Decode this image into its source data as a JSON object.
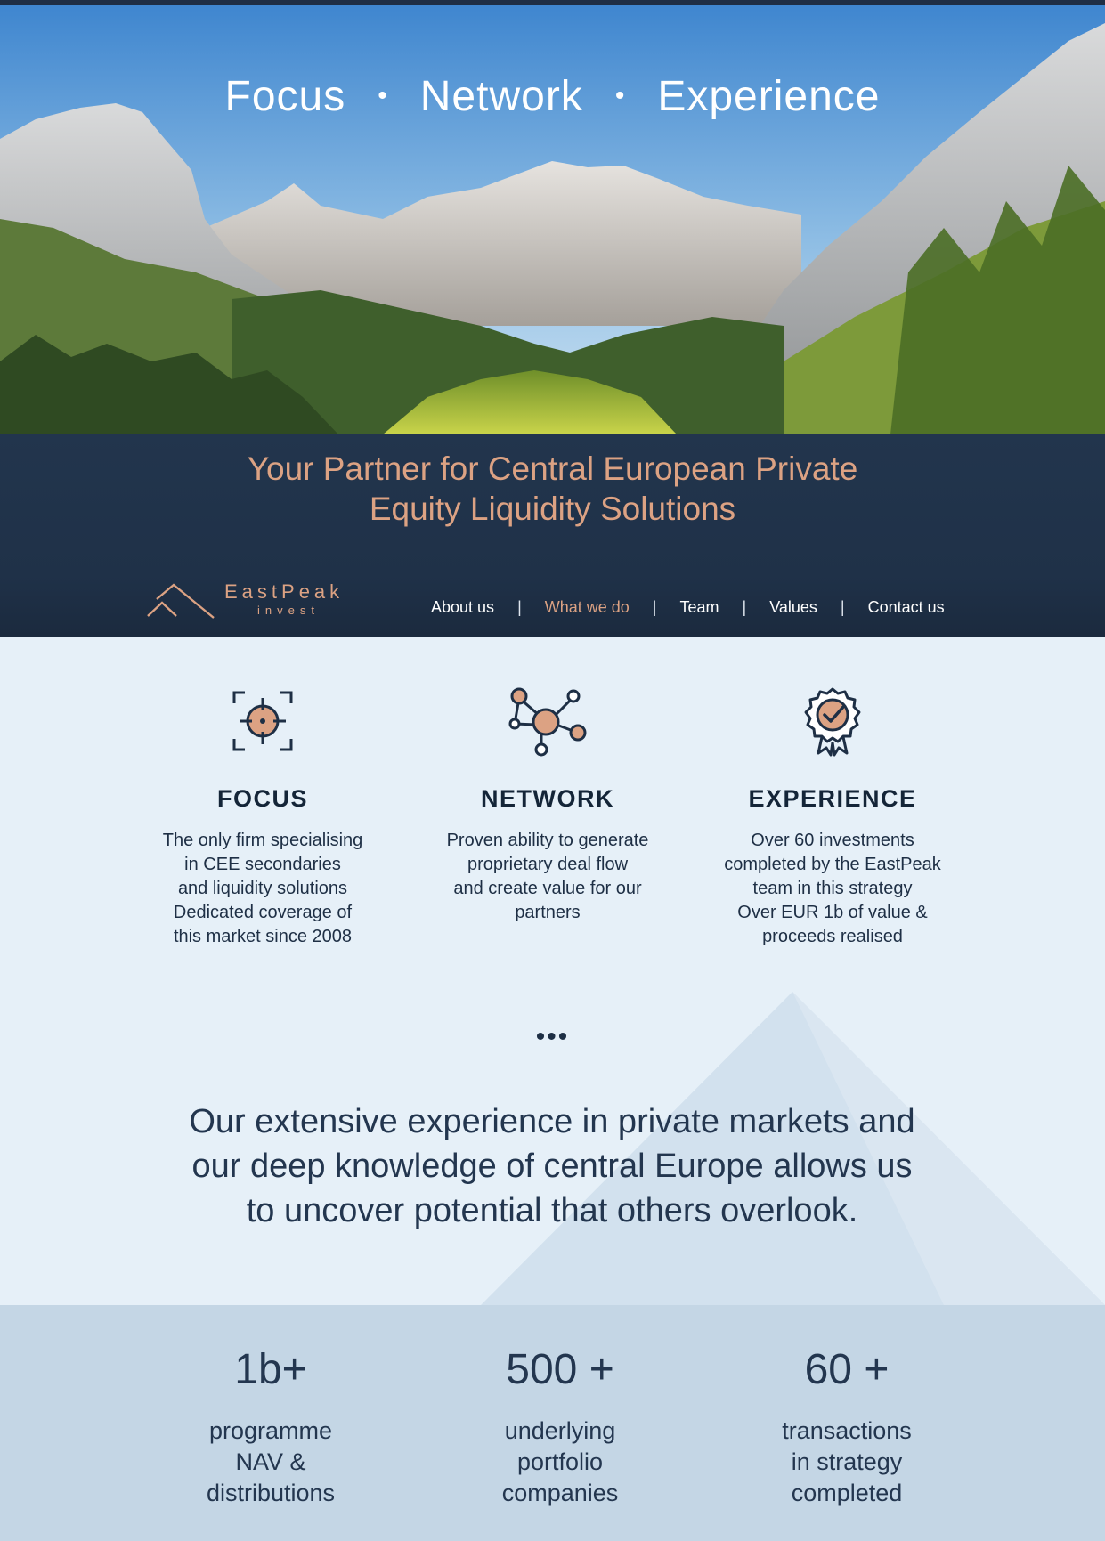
{
  "hero": {
    "tagline": [
      "Focus",
      "Network",
      "Experience"
    ],
    "separator": "•"
  },
  "banner": {
    "headline_line1": "Your Partner for Central European Private",
    "headline_line2": "Equity Liquidity Solutions"
  },
  "logo": {
    "name": "EastPeak",
    "sub": "invest",
    "icon": "mountain-logo-icon"
  },
  "nav": {
    "items": [
      "About us",
      "What we do",
      "Team",
      "Values",
      "Contact us"
    ],
    "active": "What we do",
    "separator": "|"
  },
  "features": [
    {
      "icon": "target-icon",
      "title": "FOCUS",
      "lines": [
        "The only firm specialising",
        "in CEE secondaries",
        "and liquidity solutions",
        "Dedicated coverage of",
        "this market since 2008"
      ]
    },
    {
      "icon": "network-icon",
      "title": "NETWORK",
      "lines": [
        "Proven ability to generate",
        "proprietary deal flow",
        "and create value for our",
        "partners"
      ]
    },
    {
      "icon": "award-badge-icon",
      "title": "EXPERIENCE",
      "lines": [
        "Over 60 investments",
        "completed by the EastPeak",
        "team in this strategy",
        "Over EUR 1b of value &",
        "proceeds realised"
      ]
    }
  ],
  "ellipsis": "•••",
  "quote": {
    "line1": "Our extensive experience in private markets and",
    "line2": "our deep knowledge of central Europe allows us",
    "line3": "to uncover potential that others overlook."
  },
  "stats": [
    {
      "value": "1b+",
      "label": [
        "programme",
        "NAV &",
        "distributions"
      ]
    },
    {
      "value": "500 +",
      "label": [
        "underlying",
        "portfolio",
        "companies"
      ]
    },
    {
      "value": "60 +",
      "label": [
        "transactions",
        "in strategy",
        "completed"
      ]
    }
  ],
  "colors": {
    "navy": "#1f3148",
    "accent": "#dca283",
    "background": "#e6f0f8",
    "stats_band": "#c4d6e5"
  }
}
